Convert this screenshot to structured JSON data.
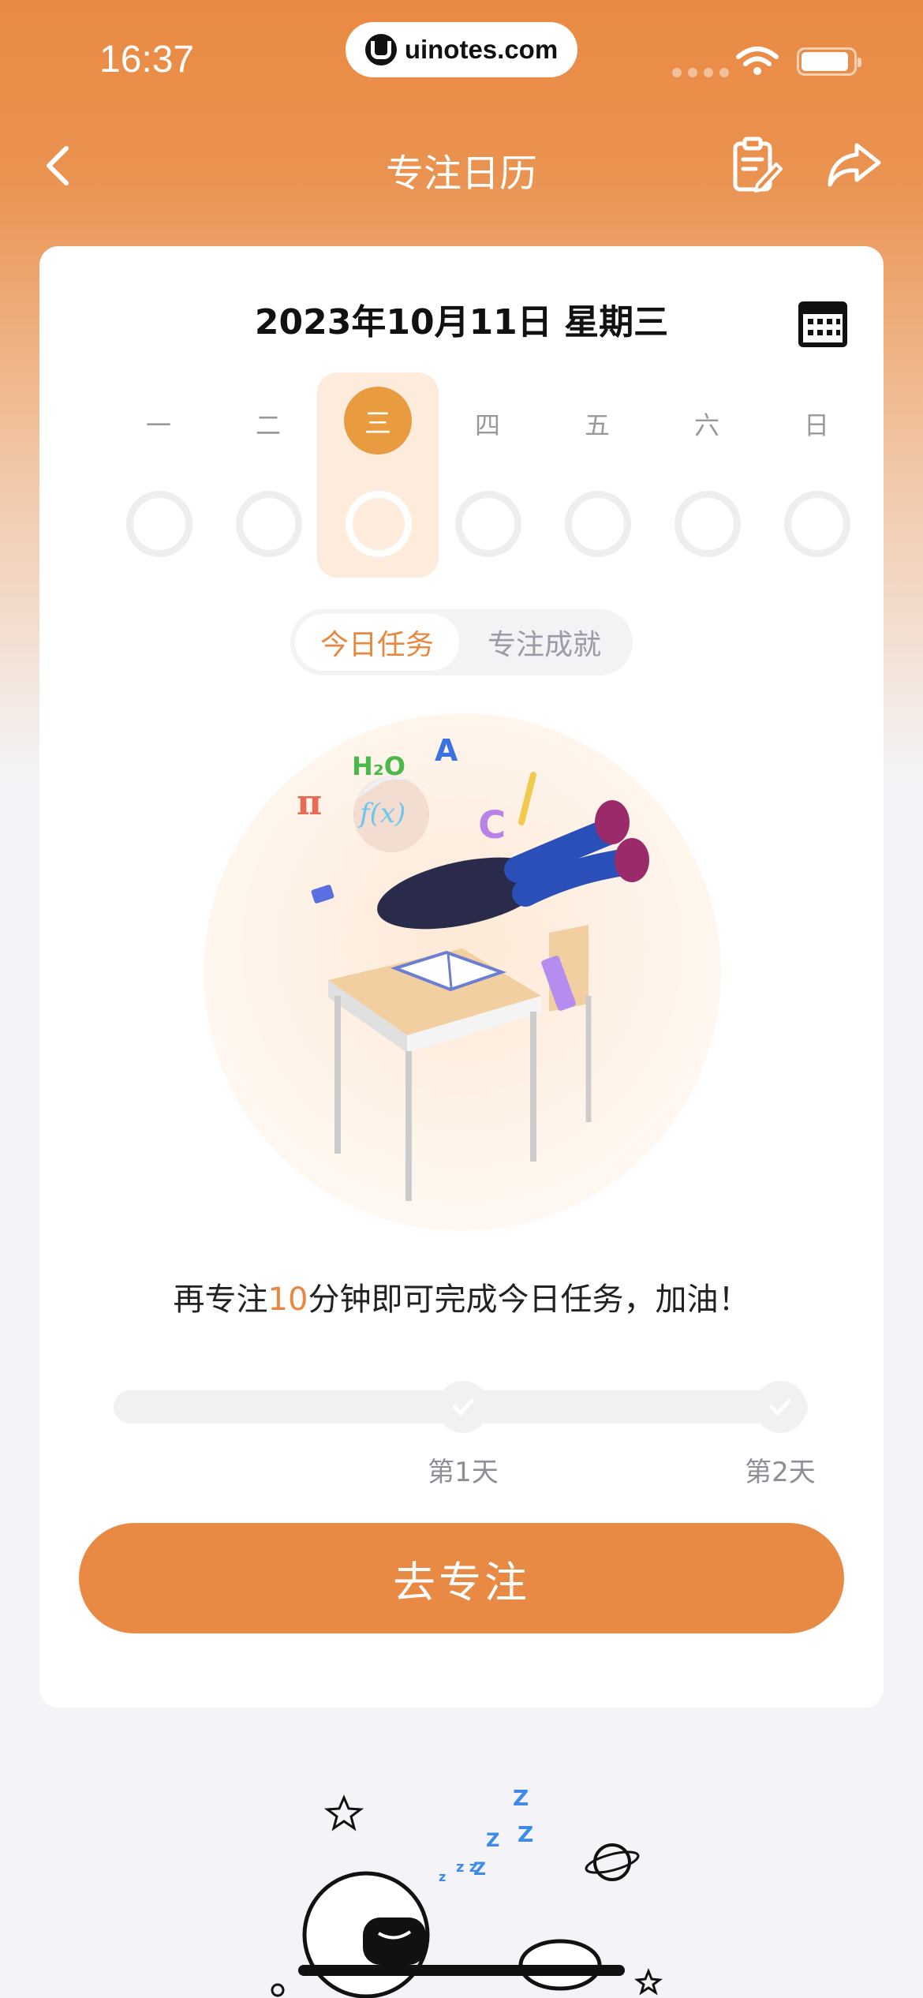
{
  "status": {
    "time": "16:37",
    "url": "uinotes.com"
  },
  "nav": {
    "title": "专注日历"
  },
  "calendar": {
    "date_title": "2023年10月11日 星期三",
    "weekdays": [
      "一",
      "二",
      "三",
      "四",
      "五",
      "六",
      "日"
    ],
    "selected_index": 2
  },
  "tabs": {
    "active": "今日任务",
    "inactive": "专注成就"
  },
  "task": {
    "prefix": "再专注",
    "minutes": "10",
    "suffix": "分钟即可完成今日任务，加油！"
  },
  "progress": {
    "milestones": [
      "第1天",
      "第2天"
    ]
  },
  "actions": {
    "go_label": "去专注"
  },
  "colors": {
    "accent": "#e88944",
    "header": "#e98a43",
    "selected_day": "#e99b40"
  }
}
